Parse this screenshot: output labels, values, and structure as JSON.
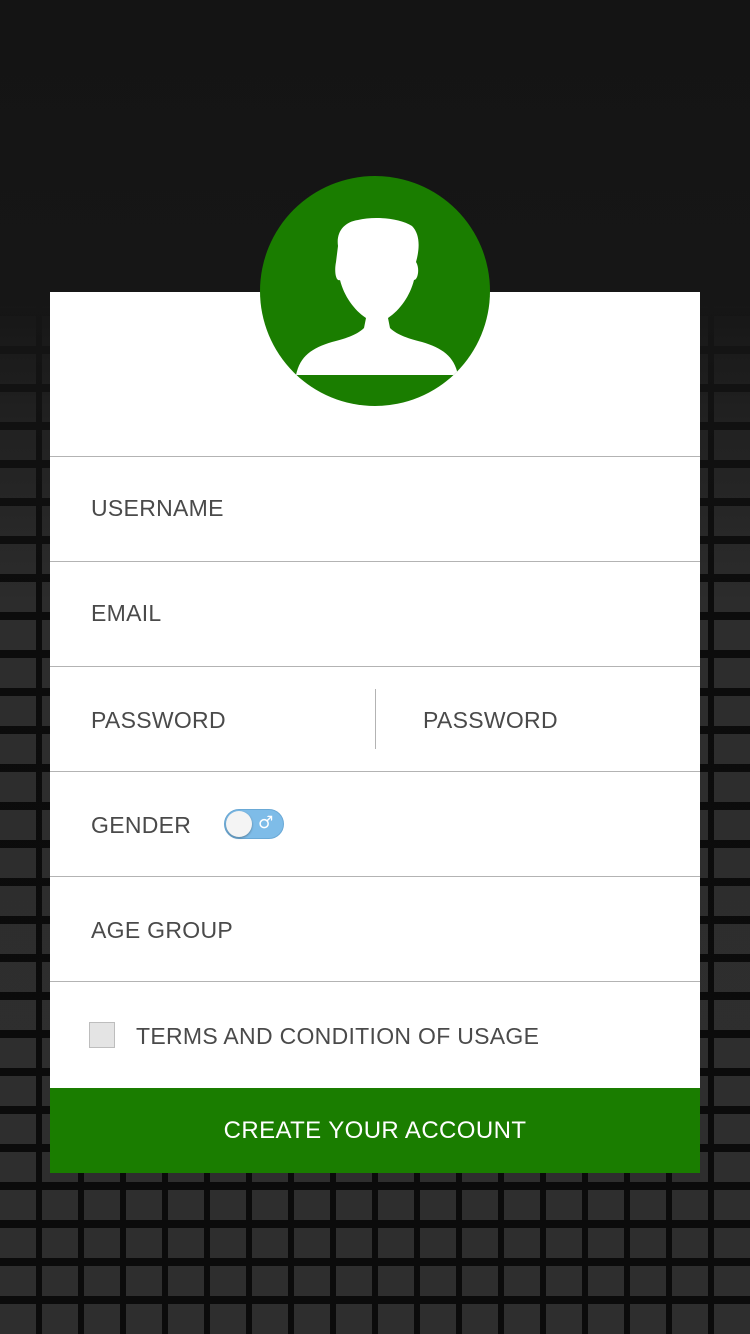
{
  "avatar": {
    "icon": "user-silhouette-icon",
    "color": "#1a7d00"
  },
  "form": {
    "username_label": "USERNAME",
    "email_label": "EMAIL",
    "password_label": "PASSWORD",
    "confirm_password_label": "PASSWORD",
    "gender_label": "GENDER",
    "gender_toggle": {
      "value": "male",
      "symbol": "♂",
      "color": "#7ebce8"
    },
    "age_group_label": "AGE GROUP",
    "terms_label": "TERMS AND CONDITION OF USAGE",
    "terms_checked": false
  },
  "cta": {
    "label": "CREATE YOUR ACCOUNT",
    "color": "#1a7d00"
  }
}
